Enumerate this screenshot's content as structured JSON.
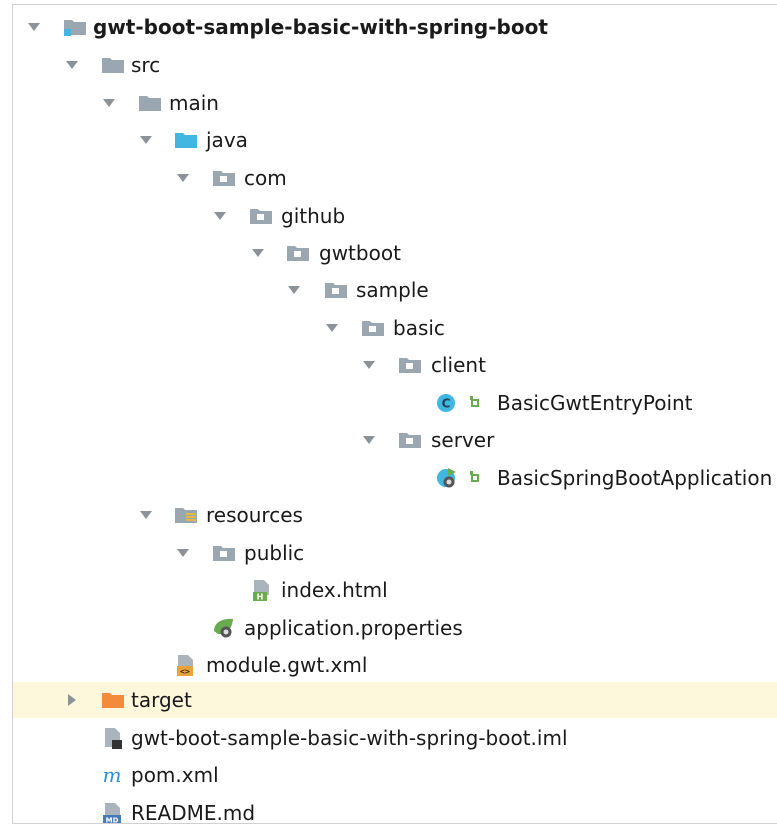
{
  "tree": {
    "root": {
      "label": "gwt-boot-sample-basic-with-spring-boot",
      "icon": "module-folder-icon",
      "expanded": true
    },
    "src": {
      "label": "src",
      "icon": "folder-icon",
      "expanded": true
    },
    "main": {
      "label": "main",
      "icon": "folder-icon",
      "expanded": true
    },
    "java": {
      "label": "java",
      "icon": "source-root-folder-icon",
      "expanded": true
    },
    "com": {
      "label": "com",
      "icon": "package-icon",
      "expanded": true
    },
    "github": {
      "label": "github",
      "icon": "package-icon",
      "expanded": true
    },
    "gwtboot": {
      "label": "gwtboot",
      "icon": "package-icon",
      "expanded": true
    },
    "sample": {
      "label": "sample",
      "icon": "package-icon",
      "expanded": true
    },
    "basic": {
      "label": "basic",
      "icon": "package-icon",
      "expanded": true
    },
    "client": {
      "label": "client",
      "icon": "package-icon",
      "expanded": true
    },
    "entry_point": {
      "label": "BasicGwtEntryPoint",
      "icon": "java-class-icon"
    },
    "server": {
      "label": "server",
      "icon": "package-icon",
      "expanded": true
    },
    "spring_app": {
      "label": "BasicSpringBootApplication",
      "icon": "spring-boot-class-icon"
    },
    "resources": {
      "label": "resources",
      "icon": "resources-folder-icon",
      "expanded": true
    },
    "public": {
      "label": "public",
      "icon": "package-icon",
      "expanded": true
    },
    "index_html": {
      "label": "index.html",
      "icon": "html-file-icon"
    },
    "app_props": {
      "label": "application.properties",
      "icon": "spring-properties-icon"
    },
    "module_gwt": {
      "label": "module.gwt.xml",
      "icon": "xml-file-icon"
    },
    "target": {
      "label": "target",
      "icon": "excluded-folder-icon",
      "expanded": false
    },
    "iml": {
      "label": "gwt-boot-sample-basic-with-spring-boot.iml",
      "icon": "iml-file-icon"
    },
    "pom": {
      "label": "pom.xml",
      "icon": "maven-icon"
    },
    "readme": {
      "label": "README.md",
      "icon": "markdown-file-icon"
    }
  },
  "colors": {
    "folder": "#9aa7b0",
    "source_root": "#40b6e0",
    "excluded": "#f28b3b",
    "class": "#40b6e0",
    "spring": "#6aab4f",
    "highlight": "#fdf8dc"
  }
}
